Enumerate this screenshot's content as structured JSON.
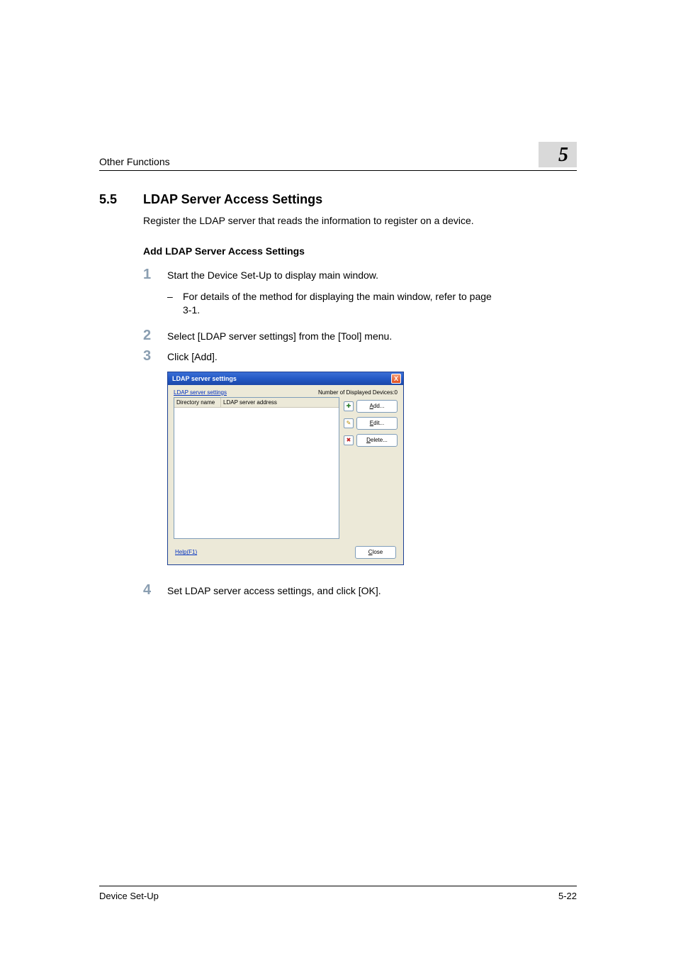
{
  "header": {
    "breadcrumb": "Other Functions",
    "chapter_number": "5"
  },
  "section": {
    "number": "5.5",
    "title": "LDAP Server Access Settings",
    "intro": "Register the LDAP server that reads the information to register on a device.",
    "subtitle": "Add LDAP Server Access Settings"
  },
  "steps": [
    {
      "num": "1",
      "text": "Start the Device Set-Up to display main window.",
      "sub": "For details of the method for displaying the main window, refer to page 3-1."
    },
    {
      "num": "2",
      "text": "Select [LDAP server settings] from the [Tool] menu."
    },
    {
      "num": "3",
      "text": "Click [Add]."
    },
    {
      "num": "4",
      "text": "Set LDAP server access settings, and click [OK]."
    }
  ],
  "dialog": {
    "title": "LDAP server settings",
    "close": "X",
    "top_link_text": "LDAP server settings",
    "count_label": "Number of Displayed Devices:0",
    "col1": "Directory name",
    "col2": "LDAP server address",
    "btn_add_prefix": "A",
    "btn_add_rest": "dd...",
    "btn_edit_prefix": "E",
    "btn_edit_rest": "dit...",
    "btn_del_prefix": "D",
    "btn_del_rest": "elete...",
    "help_prefix": "H",
    "help_rest": "elp(F1)",
    "close_btn_prefix": "C",
    "close_btn_rest": "lose",
    "icon_add": "✚",
    "icon_edit": "✎",
    "icon_del": "✖"
  },
  "footer": {
    "left": "Device Set-Up",
    "right": "5-22"
  }
}
